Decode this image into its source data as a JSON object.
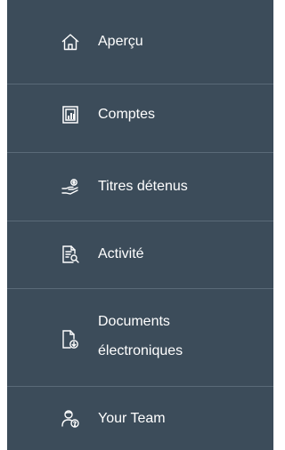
{
  "colors": {
    "background": "#3c4c5a",
    "divider": "#5a6a78",
    "text": "#ffffff"
  },
  "nav": {
    "items": [
      {
        "label": "Aperçu",
        "icon": "home-icon"
      },
      {
        "label": "Comptes",
        "icon": "accounts-icon"
      },
      {
        "label": "Titres détenus",
        "icon": "holdings-icon"
      },
      {
        "label": "Activité",
        "icon": "activity-icon"
      },
      {
        "label_line1": "Documents",
        "label_line2": "électroniques",
        "icon": "edocuments-icon"
      },
      {
        "label": "Your Team",
        "icon": "team-icon"
      }
    ]
  }
}
